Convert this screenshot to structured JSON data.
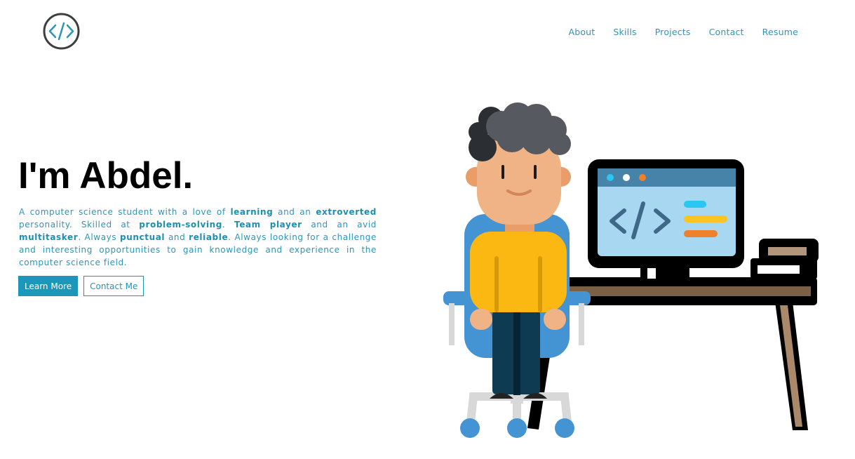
{
  "logo": {
    "icon": "code-icon",
    "color": "#2a97b8"
  },
  "nav": {
    "items": [
      "About",
      "Skills",
      "Projects",
      "Contact",
      "Resume"
    ]
  },
  "hero": {
    "title": "I'm Abdel.",
    "desc": {
      "t1": "A computer science student with a love of ",
      "b1": "learning",
      "t2": " and an ",
      "b2": "extroverted",
      "t3": " personality. Skilled at ",
      "b3": "problem-solving",
      "t4": ". ",
      "b4": "Team player",
      "t5": " and an avid ",
      "b5": "multitasker",
      "t6": ". Always ",
      "b6": "punctual",
      "t7": " and ",
      "b7": "reliable",
      "t8": ". Always looking for a challenge and interesting opportunities to gain knowledge and experience in the computer science field."
    },
    "buttons": {
      "primary": "Learn More",
      "secondary": "Contact Me"
    }
  },
  "illustration": {
    "icon": "developer-at-desk-illustration",
    "screen_icon": "code-icon",
    "colors": {
      "accent": "#1d97b9",
      "shirt": "#fbb813",
      "skin": "#efb385",
      "hair": "#56595f",
      "screen": "#a8d8f1",
      "chair": "#4494d3",
      "desk": "#7a6146"
    }
  }
}
